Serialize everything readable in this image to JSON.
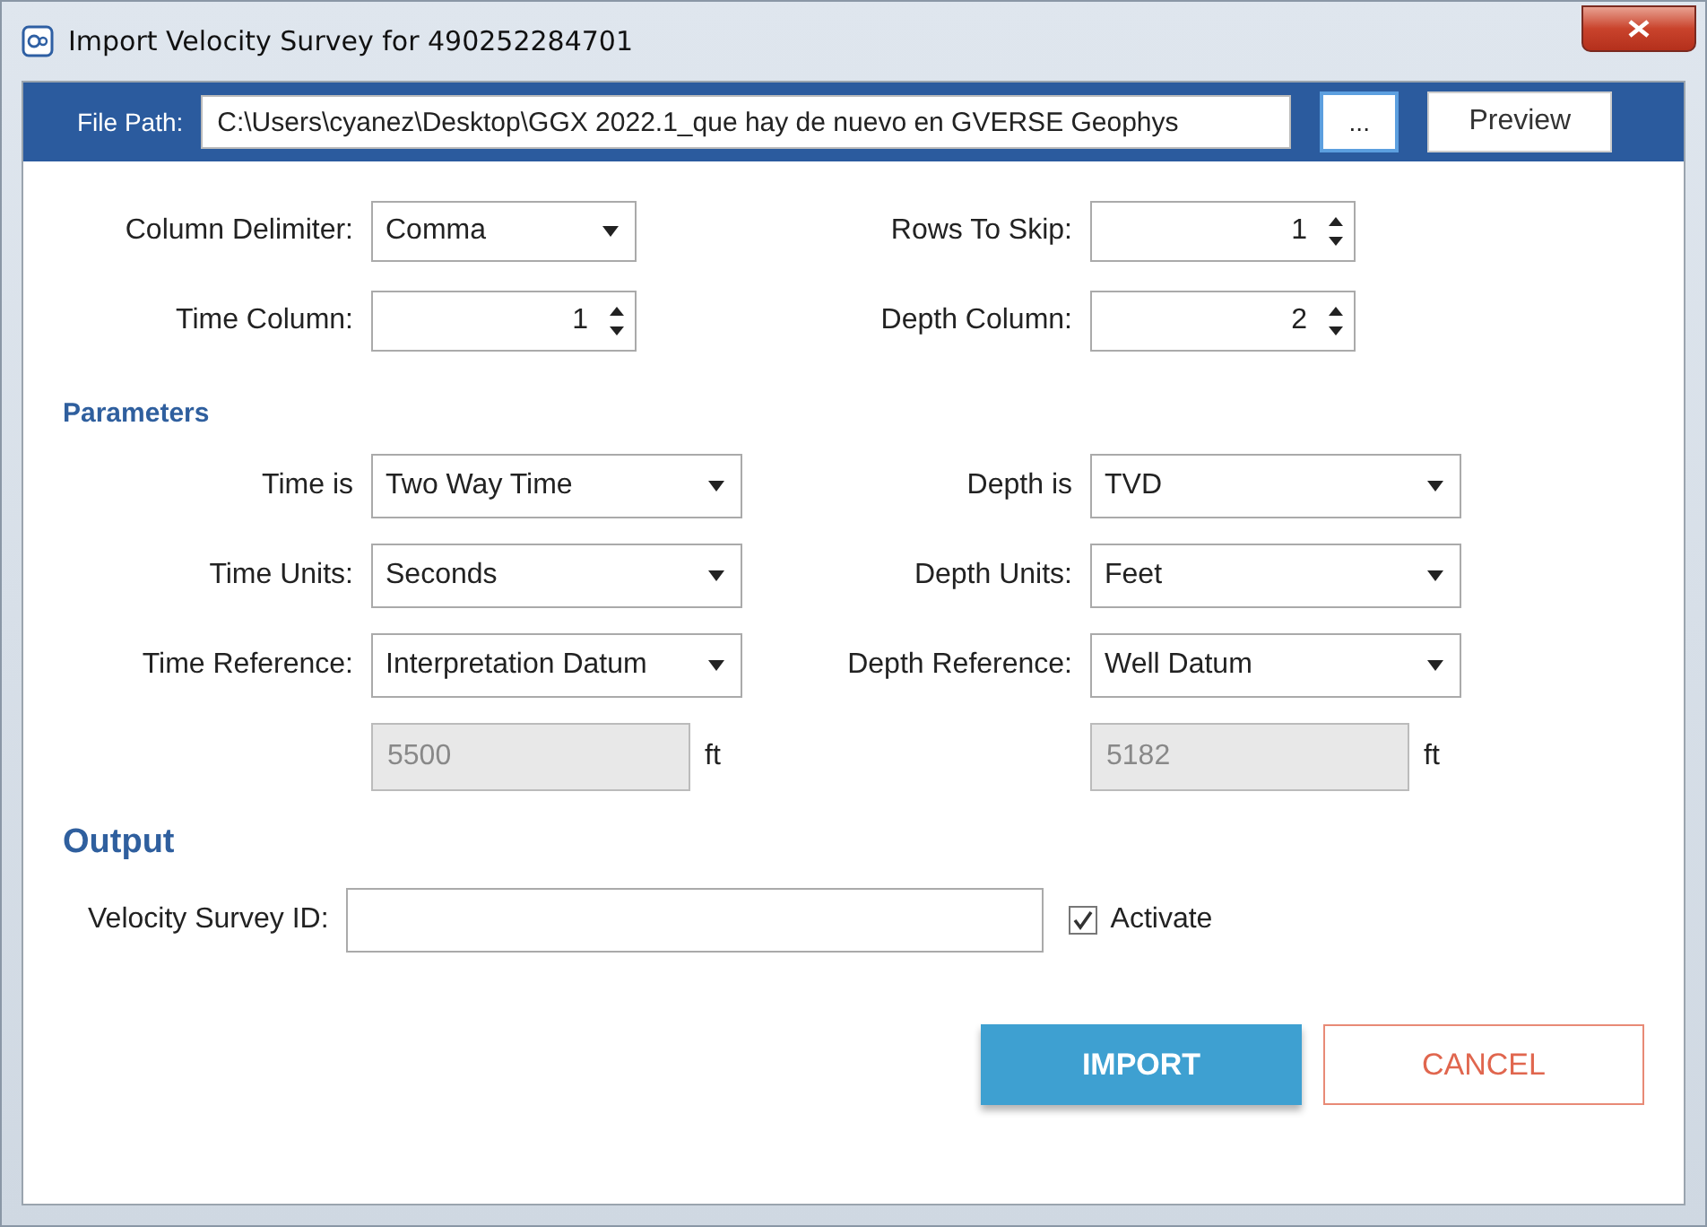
{
  "window": {
    "title": "Import Velocity Survey for 490252284701"
  },
  "file_path": {
    "label": "File Path:",
    "value": "C:\\Users\\cyanez\\Desktop\\GGX 2022.1_que hay de nuevo en GVERSE Geophys",
    "browse": "...",
    "preview": "Preview"
  },
  "settings": [
    {
      "label": "Column Delimiter:",
      "value": "Comma",
      "kind": "dropdown"
    },
    {
      "label": "Rows To Skip:",
      "value": "1",
      "kind": "spinner"
    },
    {
      "label": "Time Column:",
      "value": "1",
      "kind": "spinner"
    },
    {
      "label": "Depth Column:",
      "value": "2",
      "kind": "spinner"
    }
  ],
  "parameters": {
    "heading": "Parameters",
    "fields": [
      {
        "label": "Time is",
        "value": "Two Way Time",
        "kind": "dropdown"
      },
      {
        "label": "Depth is",
        "value": "TVD",
        "kind": "dropdown"
      },
      {
        "label": "Time Units:",
        "value": "Seconds",
        "kind": "dropdown"
      },
      {
        "label": "Depth Units:",
        "value": "Feet",
        "kind": "dropdown"
      },
      {
        "label": "Time Reference:",
        "value": "Interpretation Datum",
        "kind": "dropdown"
      },
      {
        "label": "Depth Reference:",
        "value": "Well Datum",
        "kind": "dropdown"
      },
      {
        "value": "5500",
        "unit": "ft",
        "kind": "readonly"
      },
      {
        "value": "5182",
        "unit": "ft",
        "kind": "readonly"
      }
    ]
  },
  "output": {
    "heading": "Output",
    "id_label": "Velocity Survey ID:",
    "activate": {
      "label": "Activate",
      "checked": true
    }
  },
  "buttons": [
    {
      "label": "IMPORT",
      "kind": "primary"
    },
    {
      "label": "CANCEL",
      "kind": "secondary"
    }
  ]
}
